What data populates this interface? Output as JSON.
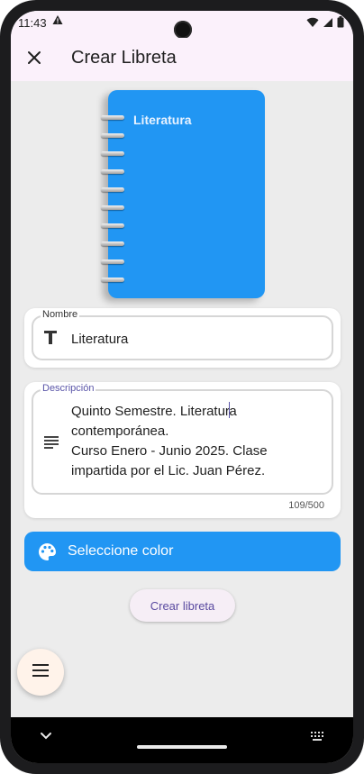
{
  "status_bar": {
    "time": "11:43",
    "alert_icon": "warning-icon",
    "icons": [
      "wifi-icon",
      "signal-icon",
      "battery-icon"
    ]
  },
  "app_bar": {
    "title": "Crear Libreta",
    "close_icon": "close-icon"
  },
  "notebook_preview": {
    "title": "Literatura",
    "color": "#2196f3",
    "ring_count": 10
  },
  "name_field": {
    "label": "Nombre",
    "value": "Literatura",
    "icon": "text-format-icon"
  },
  "description_field": {
    "label": "Descripción",
    "value_before_cursor": "Quinto Semestre. Literatur",
    "value_after_cursor": "a contemporánea.\nCurso Enero - Junio 2025. Clase impartida por el Lic. Juan Pérez.",
    "icon": "notes-icon",
    "counter": "109/500"
  },
  "color_button": {
    "label": "Seleccione color",
    "icon": "palette-icon",
    "color": "#2196f3"
  },
  "create_button": {
    "label": "Crear libreta"
  },
  "fab": {
    "icon": "menu-icon"
  },
  "navigation_bar": {
    "back_icon": "chevron-down-icon",
    "keyboard_icon": "keyboard-icon"
  }
}
